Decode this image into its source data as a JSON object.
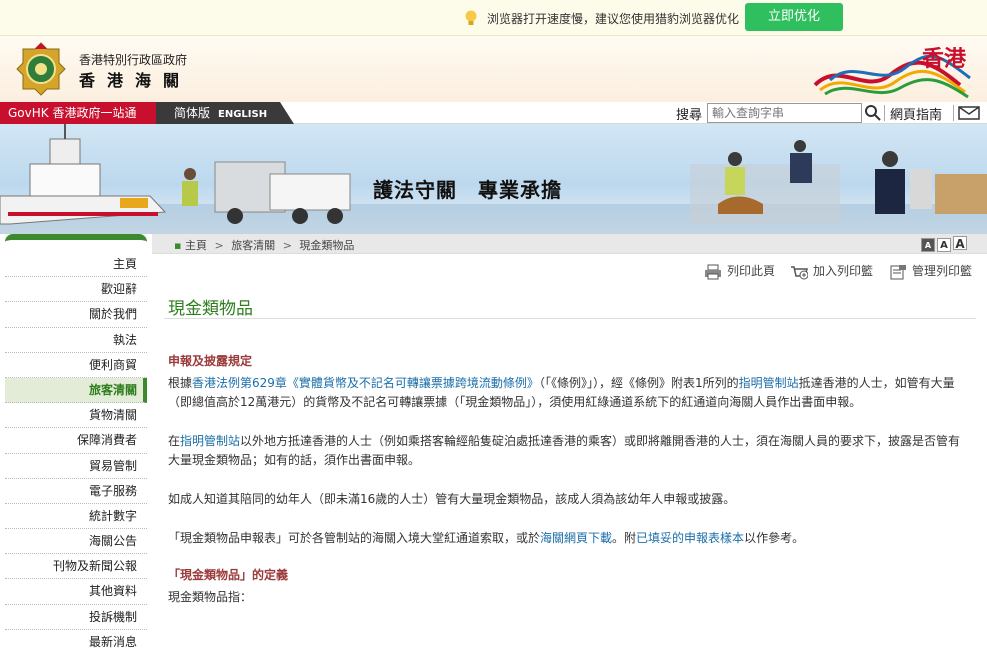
{
  "notice": {
    "message": "浏览器打开速度慢，建议您使用猎豹浏览器优化",
    "button": "立即优化"
  },
  "header": {
    "org_line1": "香港特別行政區政府",
    "org_line2": "香港海關",
    "hk_logo_text": "香港"
  },
  "nav": {
    "govhk": "GovHK 香港政府一站通",
    "simplified": "简体版",
    "english": "ENGLISH",
    "search_label": "搜尋",
    "search_placeholder": "輸入查詢字串",
    "guide": "網頁指南"
  },
  "banner": {
    "slogan": "護法守關　專業承擔"
  },
  "sidebar": {
    "items": [
      {
        "label": "主頁"
      },
      {
        "label": "歡迎辭"
      },
      {
        "label": "關於我們"
      },
      {
        "label": "執法"
      },
      {
        "label": "便利商貿"
      },
      {
        "label": "旅客清關"
      },
      {
        "label": "貨物清關"
      },
      {
        "label": "保障消費者"
      },
      {
        "label": "貿易管制"
      },
      {
        "label": "電子服務"
      },
      {
        "label": "統計數字"
      },
      {
        "label": "海關公告"
      },
      {
        "label": "刊物及新聞公報"
      },
      {
        "label": "其他資料"
      },
      {
        "label": "投訴機制"
      },
      {
        "label": "最新消息"
      }
    ]
  },
  "breadcrumb": {
    "home": "主頁",
    "level1": "旅客清關",
    "level2": "現金類物品"
  },
  "fontsize": {
    "small": "A",
    "medium": "A",
    "large": "A"
  },
  "tools": {
    "print": "列印此頁",
    "add_print": "加入列印籃",
    "manage_print": "管理列印籃"
  },
  "page": {
    "title": "現金類物品",
    "section1_heading": "申報及披露規定",
    "p1_a": "根據",
    "p1_link1": "香港法例第629章《實體貨幣及不記名可轉讓票據跨境流動條例》",
    "p1_b": "（「《條例》」），經《條例》附表1所列的",
    "p1_link2": "指明管制站",
    "p1_c": "抵達香港的人士，如管有大量（即總值高於12萬港元）的貨幣及不記名可轉讓票據（「現金類物品」），須使用紅綠通道系統下的紅通道向海關人員作出書面申報。",
    "p2_a": "在",
    "p2_link": "指明管制站",
    "p2_b": "以外地方抵達香港的人士（例如乘搭客輪經船隻碇泊處抵達香港的乘客）或即將離開香港的人士，須在海關人員的要求下，披露是否管有大量現金類物品；如有的話，須作出書面申報。",
    "p3": "如成人知道其陪同的幼年人（即未滿16歲的人士）管有大量現金類物品，該成人須為該幼年人申報或披露。",
    "p4_a": "「現金類物品申報表」可於各管制站的海關入境大堂紅通道索取，或於",
    "p4_link1": "海關網頁下載",
    "p4_b": "。附",
    "p4_link2": "已填妥的申報表樣本",
    "p4_c": "以作參考。",
    "section2_heading": "「現金類物品」的定義",
    "p5": "現金類物品指："
  },
  "colors": {
    "accent_green": "#3d8a2e",
    "govhk_red": "#c8102e",
    "optimize_button": "#2fbf5e",
    "link_blue": "#1a6ea9",
    "heading_red": "#9b3a3a"
  }
}
